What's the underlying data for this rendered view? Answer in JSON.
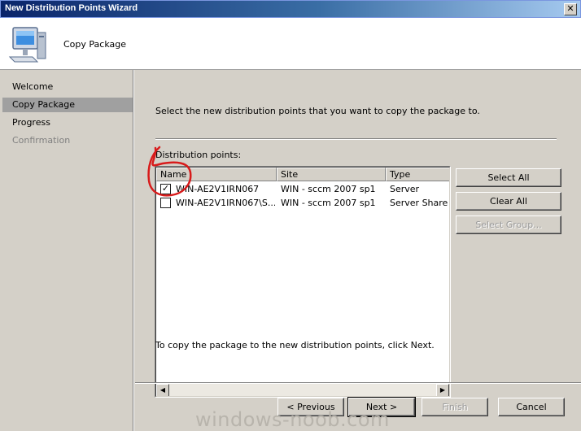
{
  "window": {
    "title": "New Distribution Points Wizard",
    "close_glyph": "✕"
  },
  "header": {
    "heading": "Copy Package",
    "icon": "computer-icon"
  },
  "sidebar": {
    "items": [
      {
        "label": "Welcome",
        "state": "normal"
      },
      {
        "label": "Copy Package",
        "state": "active"
      },
      {
        "label": "Progress",
        "state": "normal"
      },
      {
        "label": "Confirmation",
        "state": "disabled"
      }
    ]
  },
  "main": {
    "instruction": "Select the new distribution points that you want to copy the package to.",
    "list_label": "Distribution points:",
    "columns": [
      "Name",
      "Site",
      "Type"
    ],
    "rows": [
      {
        "checked": true,
        "name": "WIN-AE2V1IRN067",
        "site": "WIN - sccm 2007 sp1",
        "type": "Server"
      },
      {
        "checked": false,
        "name": "WIN-AE2V1IRN067\\S...",
        "site": "WIN - sccm 2007 sp1",
        "type": "Server Share"
      }
    ],
    "footer_text": "To copy the package to the new distribution points, click Next."
  },
  "side_buttons": {
    "select_all": "Select All",
    "clear_all": "Clear All",
    "select_group": "Select Group..."
  },
  "nav_buttons": {
    "previous": "< Previous",
    "next": "Next >",
    "finish": "Finish",
    "cancel": "Cancel"
  },
  "watermark": "windows-noob.com",
  "colors": {
    "annotation_red": "#d81b1b",
    "title_start": "#0a246a",
    "title_end": "#a6caf0"
  }
}
